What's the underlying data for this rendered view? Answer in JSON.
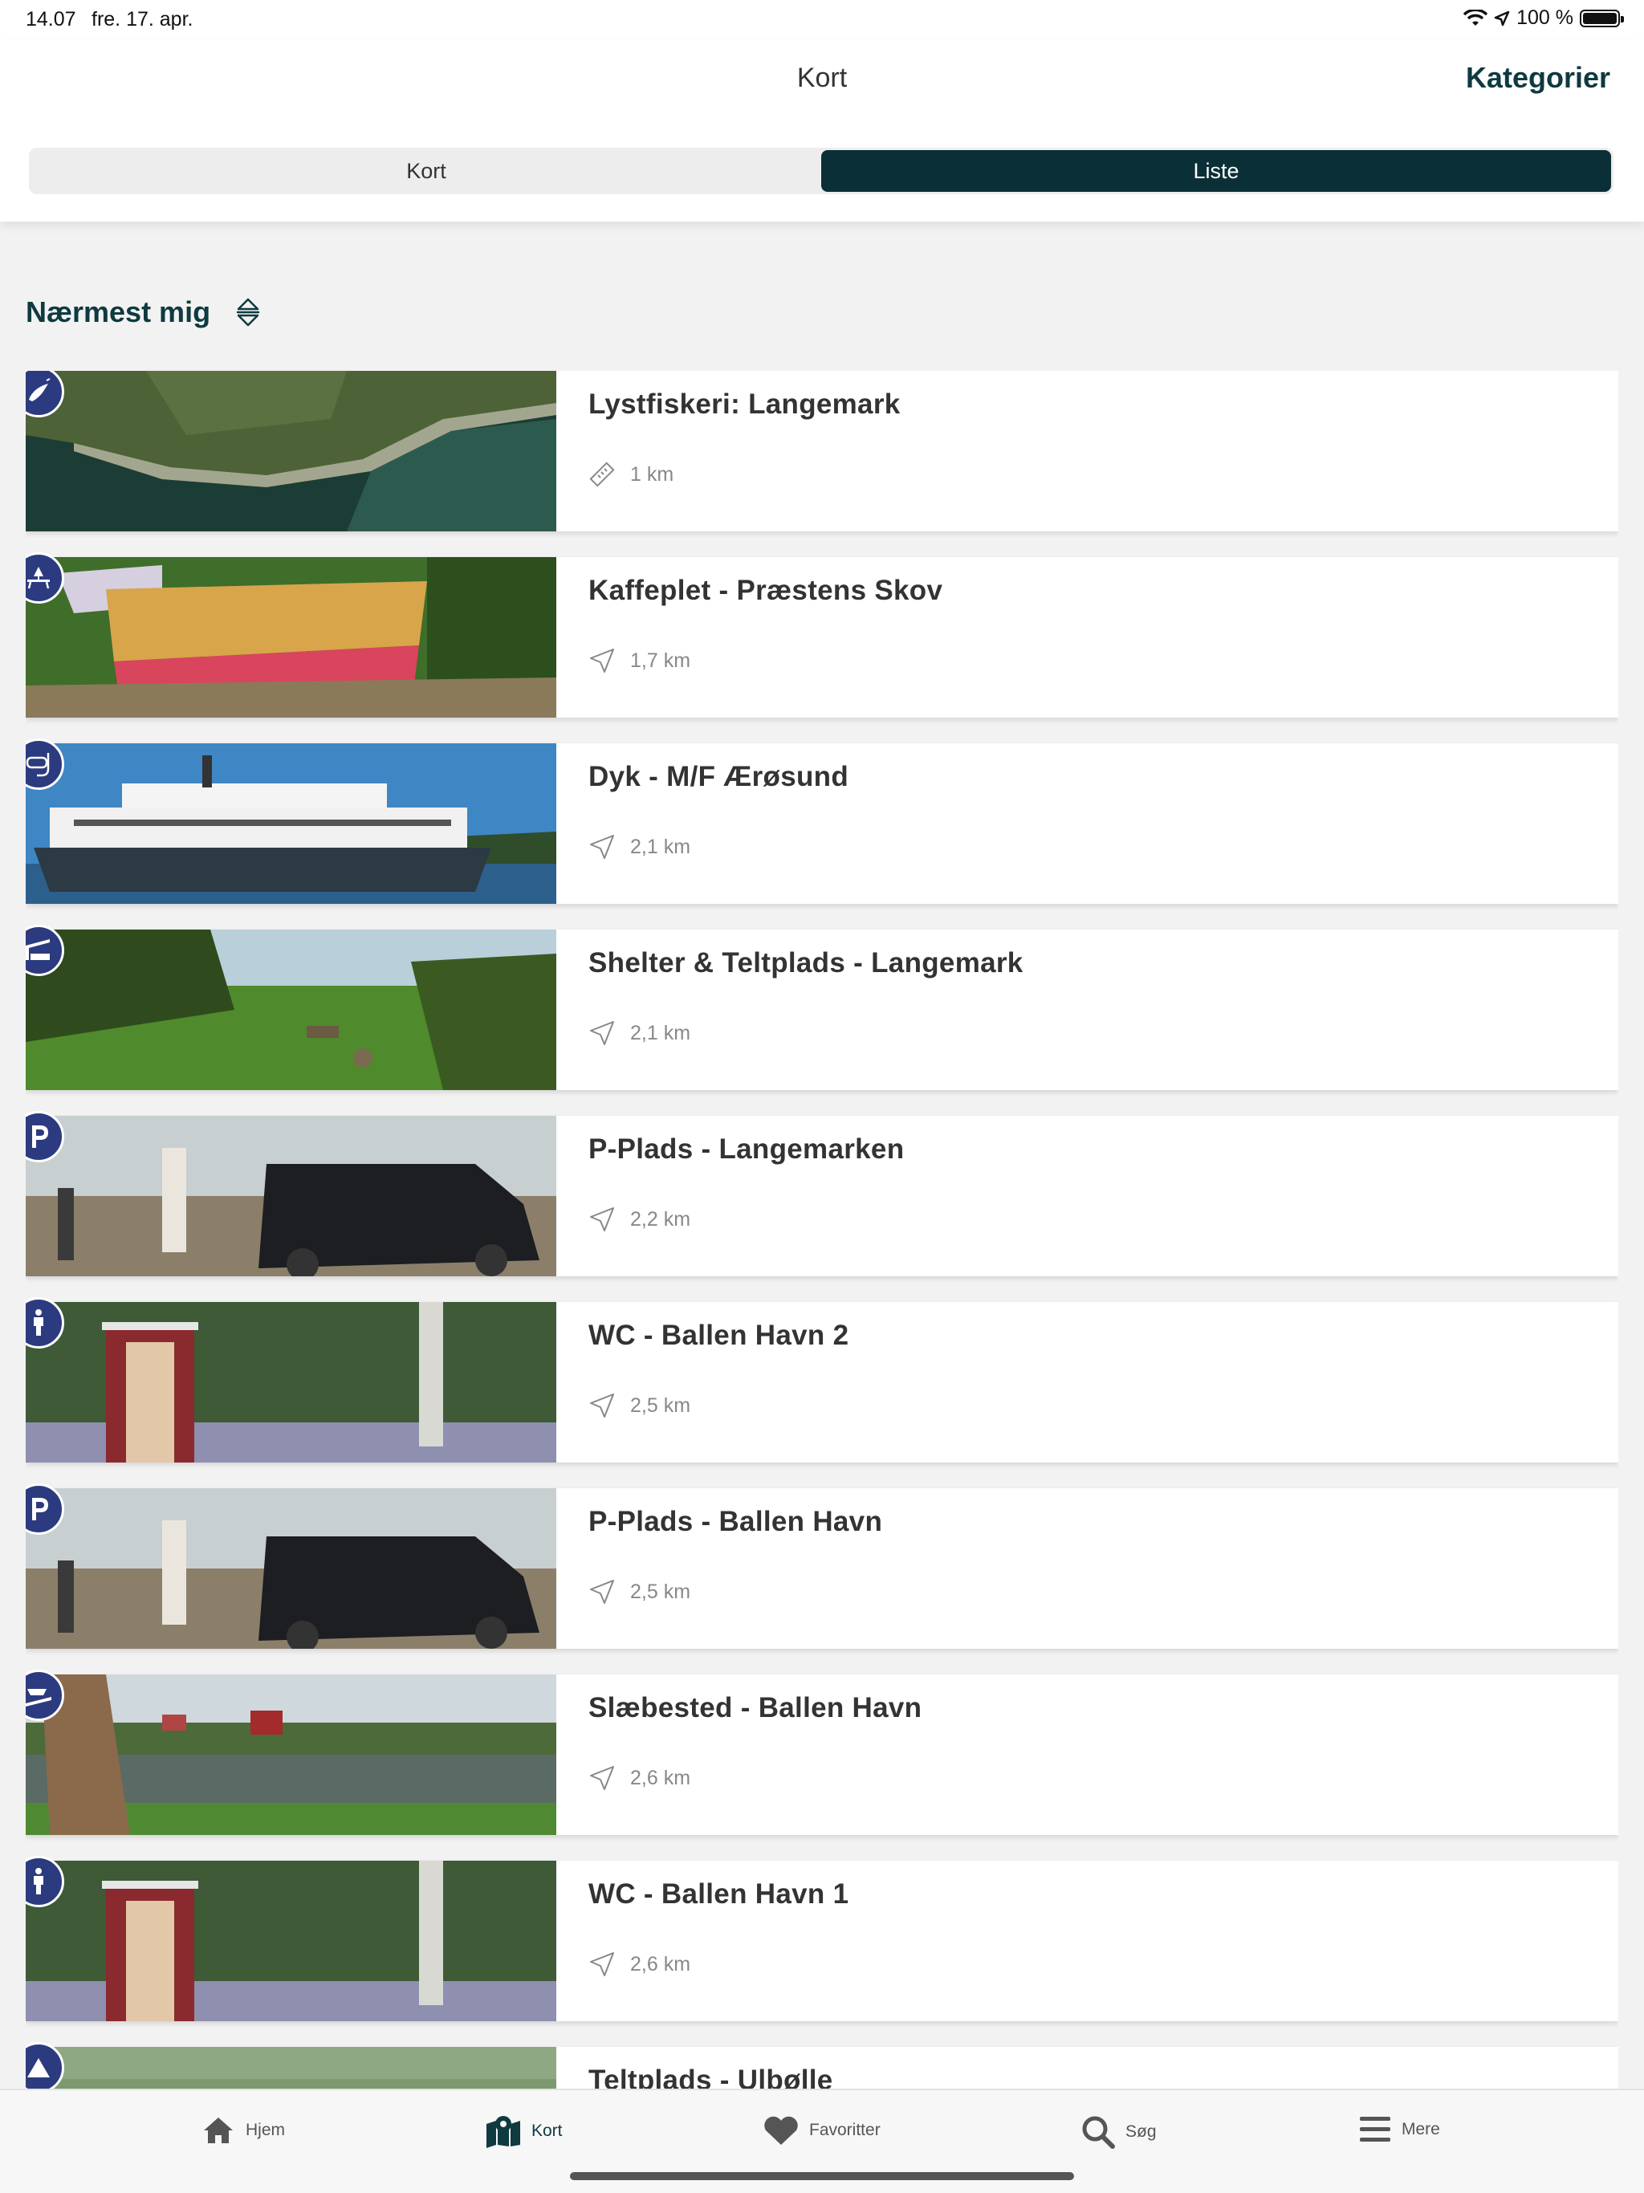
{
  "status": {
    "time": "14.07",
    "date": "fre. 17. apr.",
    "battery": "100 %"
  },
  "header": {
    "title": "Kort",
    "categories": "Kategorier"
  },
  "segments": [
    "Kort",
    "Liste"
  ],
  "active_segment": "Liste",
  "sort": {
    "label": "Nærmest mig"
  },
  "places": [
    {
      "name": "Lystfiskeri: Langemark",
      "distance": "1 km",
      "category_icon": "fishing-icon",
      "distance_icon": "ruler-icon"
    },
    {
      "name": "Kaffeplet - Præstens Skov",
      "distance": "1,7 km",
      "category_icon": "picnic-table-icon",
      "distance_icon": "navigation-arrow-icon"
    },
    {
      "name": "Dyk - M/F Ærøsund",
      "distance": "2,1 km",
      "category_icon": "diving-mask-icon",
      "distance_icon": "navigation-arrow-icon"
    },
    {
      "name": "Shelter & Teltplads - Langemark",
      "distance": "2,1 km",
      "category_icon": "shelter-icon",
      "distance_icon": "navigation-arrow-icon"
    },
    {
      "name": "P-Plads - Langemarken",
      "distance": "2,2 km",
      "category_icon": "parking-icon",
      "distance_icon": "navigation-arrow-icon"
    },
    {
      "name": "WC - Ballen Havn 2",
      "distance": "2,5 km",
      "category_icon": "toilet-person-icon",
      "distance_icon": "navigation-arrow-icon"
    },
    {
      "name": "P-Plads - Ballen Havn",
      "distance": "2,5 km",
      "category_icon": "parking-icon",
      "distance_icon": "navigation-arrow-icon"
    },
    {
      "name": "Slæbested - Ballen Havn",
      "distance": "2,6 km",
      "category_icon": "boat-ramp-icon",
      "distance_icon": "navigation-arrow-icon"
    },
    {
      "name": "WC - Ballen Havn 1",
      "distance": "2,6 km",
      "category_icon": "toilet-person-icon",
      "distance_icon": "navigation-arrow-icon"
    },
    {
      "name": "Teltplads - Ulbølle",
      "distance": "",
      "category_icon": "tent-icon",
      "distance_icon": ""
    }
  ],
  "tabs": [
    {
      "label": "Hjem",
      "icon": "home-icon"
    },
    {
      "label": "Kort",
      "icon": "map-pin-icon"
    },
    {
      "label": "Favoritter",
      "icon": "heart-icon"
    },
    {
      "label": "Søg",
      "icon": "search-icon"
    },
    {
      "label": "Mere",
      "icon": "menu-icon"
    }
  ],
  "active_tab": "Kort",
  "colors": {
    "accent": "#0b2f36",
    "badge": "#2c3b7f",
    "background": "#f2f2f2"
  }
}
